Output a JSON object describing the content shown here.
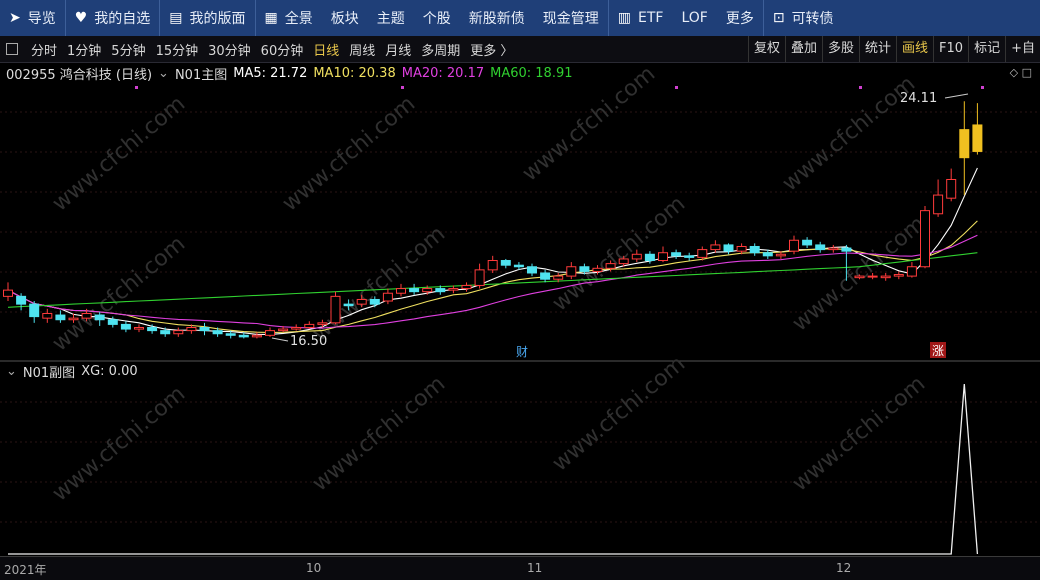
{
  "topnav": {
    "items": [
      {
        "icon": "navigate-icon",
        "glyph": "➤",
        "label": "导览"
      },
      {
        "icon": "heart-icon",
        "glyph": "♥",
        "label": "我的自选"
      },
      {
        "icon": "layout-icon",
        "glyph": "▤",
        "label": "我的版面"
      },
      {
        "icon": "panorama-icon",
        "glyph": "▦",
        "label": "全景"
      },
      {
        "icon": "",
        "glyph": "",
        "label": "板块"
      },
      {
        "icon": "",
        "glyph": "",
        "label": "主题"
      },
      {
        "icon": "",
        "glyph": "",
        "label": "个股"
      },
      {
        "icon": "",
        "glyph": "",
        "label": "新股新债"
      },
      {
        "icon": "",
        "glyph": "",
        "label": "现金管理"
      },
      {
        "icon": "bar-chart-icon",
        "glyph": "▥",
        "label": "ETF"
      },
      {
        "icon": "",
        "glyph": "",
        "label": "LOF"
      },
      {
        "icon": "",
        "glyph": "",
        "label": "更多"
      },
      {
        "icon": "convertible-icon",
        "glyph": "⊡",
        "label": "可转债"
      }
    ]
  },
  "toolbar": {
    "periods": [
      "分时",
      "1分钟",
      "5分钟",
      "15分钟",
      "30分钟",
      "60分钟",
      "日线",
      "周线",
      "月线",
      "多周期",
      "更多 〉"
    ],
    "active_period": "日线",
    "right_buttons": [
      "复权",
      "叠加",
      "多股",
      "统计",
      "画线",
      "F10",
      "标记",
      "+自"
    ],
    "highlighted_button": "画线"
  },
  "main_header": {
    "stock": "002955 鸿合科技 (日线)",
    "indicator": "N01主图",
    "ma5": "MA5: 21.72",
    "ma10": "MA10: 20.38",
    "ma20": "MA20: 20.17",
    "ma60": "MA60: 18.91"
  },
  "sub_header": {
    "indicator": "N01副图",
    "xg": "XG: 0.00"
  },
  "annotations": {
    "high_label": "24.11",
    "low_label": "16.50",
    "finance_marker": "财",
    "rise_marker": "涨"
  },
  "watermark": "www.cfchi.com",
  "xaxis": {
    "labels": [
      "2021年",
      "10",
      "11",
      "12"
    ]
  },
  "colors": {
    "up": "#ff3b3b",
    "down": "#4fe3f0",
    "ma5": "#ffffff",
    "ma10": "#f0e060",
    "ma20": "#e040e0",
    "ma60": "#30d030",
    "nav_bg": "#1f3f78",
    "highlight": "#e8c64a"
  },
  "chart_data": {
    "type": "candlestick",
    "y_unit": "price",
    "ylim": [
      16.0,
      24.6
    ],
    "candles": [
      [
        17.85,
        18.05,
        18.3,
        17.7
      ],
      [
        17.85,
        17.6,
        17.95,
        17.4
      ],
      [
        17.6,
        17.2,
        17.7,
        17.0
      ],
      [
        17.15,
        17.3,
        17.45,
        17.0
      ],
      [
        17.25,
        17.1,
        17.4,
        17.0
      ],
      [
        17.1,
        17.15,
        17.3,
        17.0
      ],
      [
        17.15,
        17.3,
        17.45,
        17.05
      ],
      [
        17.25,
        17.1,
        17.35,
        16.9
      ],
      [
        17.1,
        16.95,
        17.2,
        16.85
      ],
      [
        16.95,
        16.8,
        17.05,
        16.7
      ],
      [
        16.8,
        16.85,
        16.95,
        16.7
      ],
      [
        16.85,
        16.75,
        16.95,
        16.65
      ],
      [
        16.75,
        16.65,
        16.85,
        16.55
      ],
      [
        16.65,
        16.75,
        16.85,
        16.55
      ],
      [
        16.75,
        16.85,
        16.95,
        16.65
      ],
      [
        16.85,
        16.75,
        17.0,
        16.6
      ],
      [
        16.75,
        16.65,
        16.85,
        16.55
      ],
      [
        16.65,
        16.6,
        16.75,
        16.5
      ],
      [
        16.6,
        16.55,
        16.7,
        16.5
      ],
      [
        16.55,
        16.6,
        16.7,
        16.5
      ],
      [
        16.6,
        16.75,
        16.85,
        16.55
      ],
      [
        16.75,
        16.8,
        16.9,
        16.7
      ],
      [
        16.8,
        16.85,
        16.95,
        16.75
      ],
      [
        16.85,
        16.95,
        17.05,
        16.8
      ],
      [
        16.95,
        17.0,
        17.1,
        16.85
      ],
      [
        17.0,
        17.85,
        18.0,
        16.95
      ],
      [
        17.6,
        17.55,
        17.75,
        17.4
      ],
      [
        17.6,
        17.75,
        17.9,
        17.5
      ],
      [
        17.75,
        17.6,
        17.85,
        17.5
      ],
      [
        17.7,
        17.95,
        18.1,
        17.6
      ],
      [
        17.95,
        18.1,
        18.25,
        17.85
      ],
      [
        18.1,
        18.0,
        18.25,
        17.9
      ],
      [
        18.0,
        18.1,
        18.2,
        17.9
      ],
      [
        18.1,
        18.0,
        18.2,
        17.9
      ],
      [
        18.05,
        18.1,
        18.2,
        17.95
      ],
      [
        18.1,
        18.2,
        18.3,
        18.0
      ],
      [
        18.2,
        18.7,
        18.9,
        18.1
      ],
      [
        18.7,
        19.0,
        19.15,
        18.6
      ],
      [
        19.0,
        18.85,
        19.05,
        18.75
      ],
      [
        18.85,
        18.8,
        18.95,
        18.7
      ],
      [
        18.8,
        18.6,
        18.9,
        18.5
      ],
      [
        18.6,
        18.4,
        18.7,
        18.3
      ],
      [
        18.4,
        18.5,
        18.6,
        18.3
      ],
      [
        18.5,
        18.8,
        18.95,
        18.4
      ],
      [
        18.8,
        18.65,
        18.9,
        18.55
      ],
      [
        18.65,
        18.75,
        18.85,
        18.55
      ],
      [
        18.75,
        18.9,
        19.0,
        18.65
      ],
      [
        18.9,
        19.05,
        19.15,
        18.8
      ],
      [
        19.05,
        19.2,
        19.35,
        18.95
      ],
      [
        19.2,
        19.0,
        19.3,
        18.9
      ],
      [
        19.0,
        19.25,
        19.45,
        18.95
      ],
      [
        19.25,
        19.15,
        19.35,
        19.05
      ],
      [
        19.15,
        19.1,
        19.25,
        19.0
      ],
      [
        19.1,
        19.35,
        19.45,
        19.0
      ],
      [
        19.35,
        19.5,
        19.65,
        19.25
      ],
      [
        19.5,
        19.3,
        19.55,
        19.2
      ],
      [
        19.3,
        19.45,
        19.55,
        19.2
      ],
      [
        19.45,
        19.25,
        19.55,
        19.15
      ],
      [
        19.25,
        19.15,
        19.35,
        19.05
      ],
      [
        19.15,
        19.2,
        19.3,
        19.05
      ],
      [
        19.3,
        19.65,
        19.8,
        19.2
      ],
      [
        19.65,
        19.5,
        19.75,
        19.4
      ],
      [
        19.5,
        19.35,
        19.6,
        19.25
      ],
      [
        19.35,
        19.4,
        19.5,
        19.25
      ],
      [
        19.4,
        19.3,
        19.5,
        18.35
      ],
      [
        18.45,
        18.5,
        18.55,
        18.4
      ],
      [
        18.5,
        18.5,
        18.6,
        18.4
      ],
      [
        18.45,
        18.5,
        18.6,
        18.35
      ],
      [
        18.5,
        18.55,
        18.65,
        18.4
      ],
      [
        18.5,
        18.8,
        18.95,
        18.45
      ],
      [
        18.8,
        20.6,
        20.75,
        18.75
      ],
      [
        20.5,
        21.1,
        21.6,
        20.4
      ],
      [
        21.0,
        21.6,
        21.95,
        20.9
      ],
      [
        22.3,
        23.2,
        24.11,
        21.1
      ],
      [
        22.5,
        23.35,
        24.05,
        22.4
      ]
    ],
    "xg_values": [
      0,
      0,
      0,
      0,
      0,
      0,
      0,
      0,
      0,
      0,
      0,
      0,
      0,
      0,
      0,
      0,
      0,
      0,
      0,
      0,
      0,
      0,
      0,
      0,
      0,
      0,
      0,
      0,
      0,
      0,
      0,
      0,
      0,
      0,
      0,
      0,
      0,
      0,
      0,
      0,
      0,
      0,
      0,
      0,
      0,
      0,
      0,
      0,
      0,
      0,
      0,
      0,
      0,
      0,
      0,
      0,
      0,
      0,
      0,
      0,
      0,
      0,
      0,
      0,
      0,
      0,
      0,
      0,
      0,
      0,
      0,
      0,
      0,
      1,
      0
    ]
  }
}
